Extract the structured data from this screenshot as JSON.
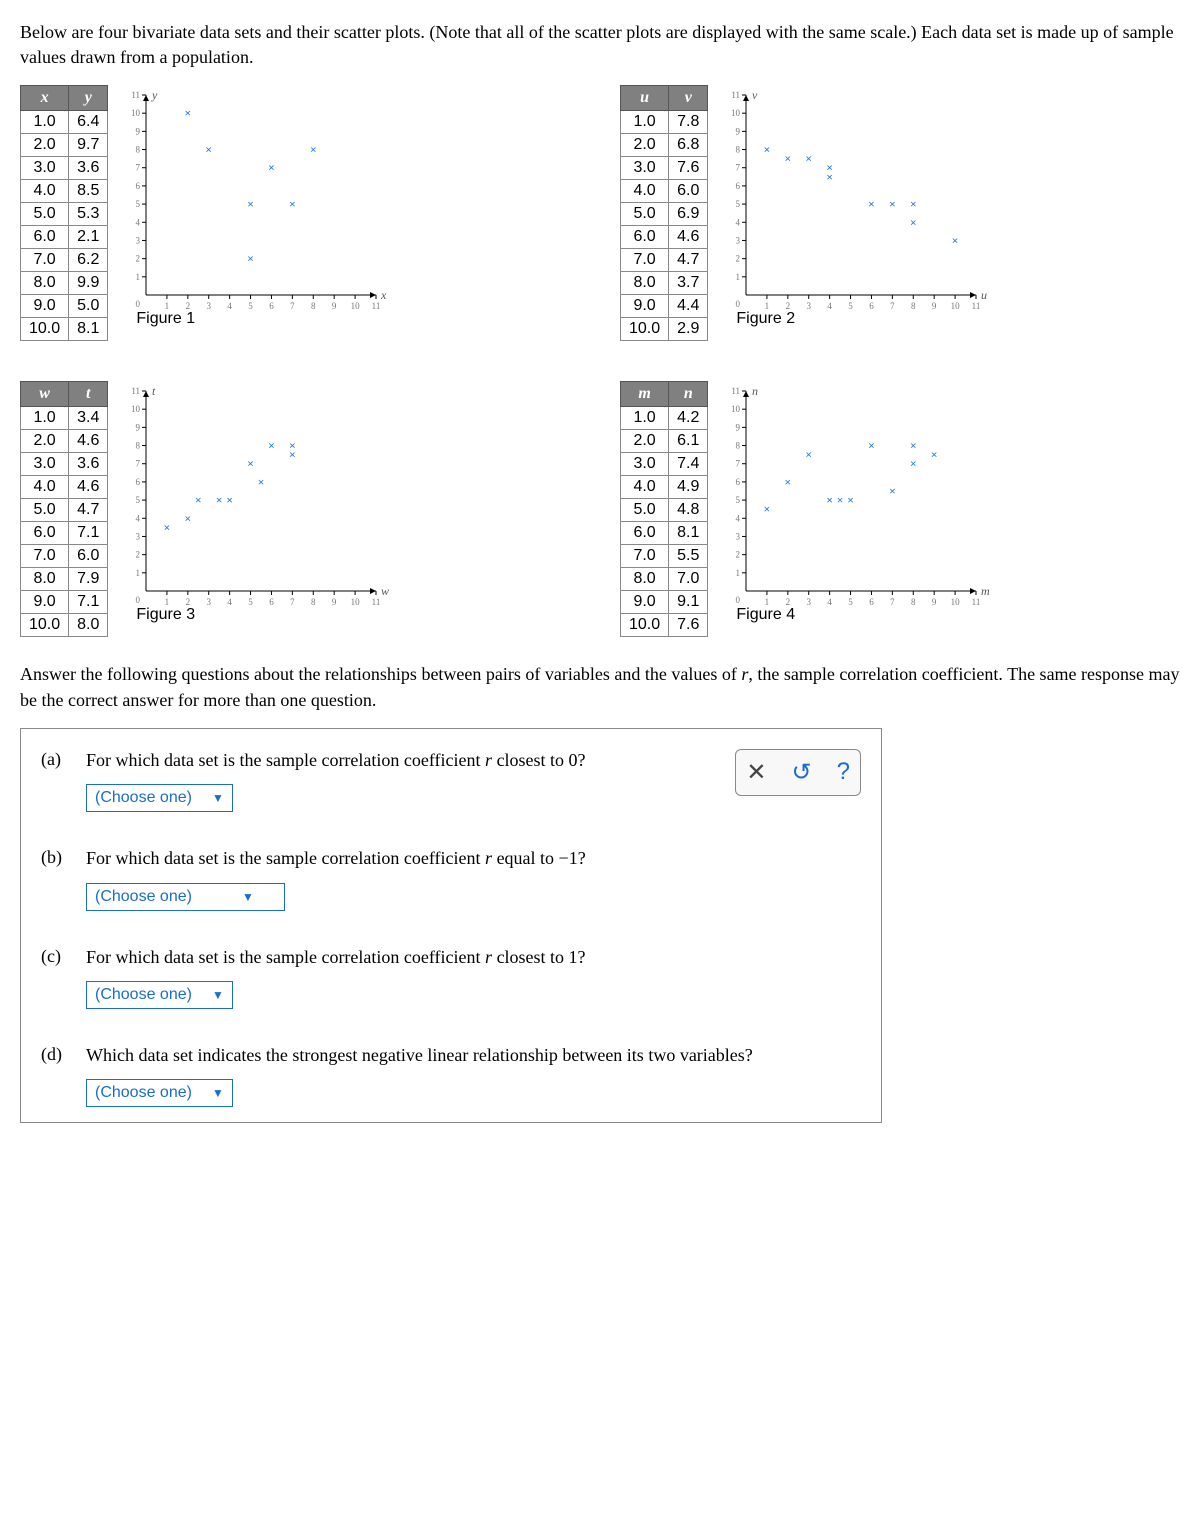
{
  "intro": "Below are four bivariate data sets and their scatter plots. (Note that all of the scatter plots are displayed with the same scale.) Each data set is made up of sample values drawn from a population.",
  "middle": "Answer the following questions about the relationships between pairs of variables and the values of r, the sample correlation coefficient. The same response may be the correct answer for more than one question.",
  "chart_data": [
    {
      "type": "scatter",
      "title": "Figure 1",
      "xvar": "x",
      "yvar": "y",
      "xlabel": "x",
      "ylabel": "y",
      "xlim": [
        0,
        11
      ],
      "ylim": [
        0,
        11
      ],
      "x": [
        1,
        2,
        3,
        4,
        5,
        6,
        7,
        8,
        9,
        10
      ],
      "y": [
        6.4,
        9.7,
        3.6,
        8.5,
        5.3,
        2.1,
        6.2,
        9.9,
        5.0,
        8.1
      ],
      "plot_points": [
        [
          2,
          10
        ],
        [
          3,
          8
        ],
        [
          5,
          5
        ],
        [
          5,
          2
        ],
        [
          6,
          7
        ],
        [
          7,
          5
        ],
        [
          8,
          8
        ]
      ]
    },
    {
      "type": "scatter",
      "title": "Figure 2",
      "xvar": "u",
      "yvar": "v",
      "xlabel": "u",
      "ylabel": "v",
      "xlim": [
        0,
        11
      ],
      "ylim": [
        0,
        11
      ],
      "x": [
        1,
        2,
        3,
        4,
        5,
        6,
        7,
        8,
        9,
        10
      ],
      "y": [
        7.8,
        6.8,
        7.6,
        6.0,
        6.9,
        4.6,
        4.7,
        3.7,
        4.4,
        2.9
      ],
      "plot_points": [
        [
          1,
          8
        ],
        [
          2,
          7.5
        ],
        [
          3,
          7.5
        ],
        [
          4,
          6.5
        ],
        [
          4,
          7
        ],
        [
          6,
          5
        ],
        [
          7,
          5
        ],
        [
          8,
          4
        ],
        [
          8,
          5
        ],
        [
          10,
          3
        ]
      ]
    },
    {
      "type": "scatter",
      "title": "Figure 3",
      "xvar": "w",
      "yvar": "t",
      "xlabel": "w",
      "ylabel": "t",
      "xlim": [
        0,
        11
      ],
      "ylim": [
        0,
        11
      ],
      "x": [
        1,
        2,
        3,
        4,
        5,
        6,
        7,
        8,
        9,
        10
      ],
      "y": [
        3.4,
        4.6,
        3.6,
        4.6,
        4.7,
        7.1,
        6.0,
        7.9,
        7.1,
        8.0
      ],
      "plot_points": [
        [
          1,
          3.5
        ],
        [
          2,
          4
        ],
        [
          2.5,
          5
        ],
        [
          4,
          5
        ],
        [
          3.5,
          5
        ],
        [
          5,
          7
        ],
        [
          5.5,
          6
        ],
        [
          6,
          8
        ],
        [
          7,
          7.5
        ],
        [
          7,
          8
        ]
      ]
    },
    {
      "type": "scatter",
      "title": "Figure 4",
      "xvar": "m",
      "yvar": "n",
      "xlabel": "m",
      "ylabel": "n",
      "xlim": [
        0,
        11
      ],
      "ylim": [
        0,
        11
      ],
      "x": [
        1,
        2,
        3,
        4,
        5,
        6,
        7,
        8,
        9,
        10
      ],
      "y": [
        4.2,
        6.1,
        7.4,
        4.9,
        4.8,
        8.1,
        5.5,
        7.0,
        9.1,
        7.6
      ],
      "plot_points": [
        [
          1,
          4.5
        ],
        [
          2,
          6
        ],
        [
          3,
          7.5
        ],
        [
          4,
          5
        ],
        [
          4.5,
          5
        ],
        [
          5,
          5
        ],
        [
          6,
          8
        ],
        [
          7,
          5.5
        ],
        [
          8,
          8
        ],
        [
          8,
          7
        ],
        [
          9,
          7.5
        ]
      ]
    }
  ],
  "questions": {
    "a": {
      "label": "(a)",
      "text": "For which data set is the sample correlation coefficient r closest to 0?",
      "placeholder": "(Choose one)"
    },
    "b": {
      "label": "(b)",
      "text": "For which data set is the sample correlation coefficient r equal to −1?",
      "placeholder": "(Choose one)"
    },
    "c": {
      "label": "(c)",
      "text": "For which data set is the sample correlation coefficient r closest to 1?",
      "placeholder": "(Choose one)"
    },
    "d": {
      "label": "(d)",
      "text": "Which data set indicates the strongest negative linear relationship between its two variables?",
      "placeholder": "(Choose one)"
    }
  },
  "actions": {
    "clear": "✕",
    "reset": "↺",
    "help": "?"
  }
}
